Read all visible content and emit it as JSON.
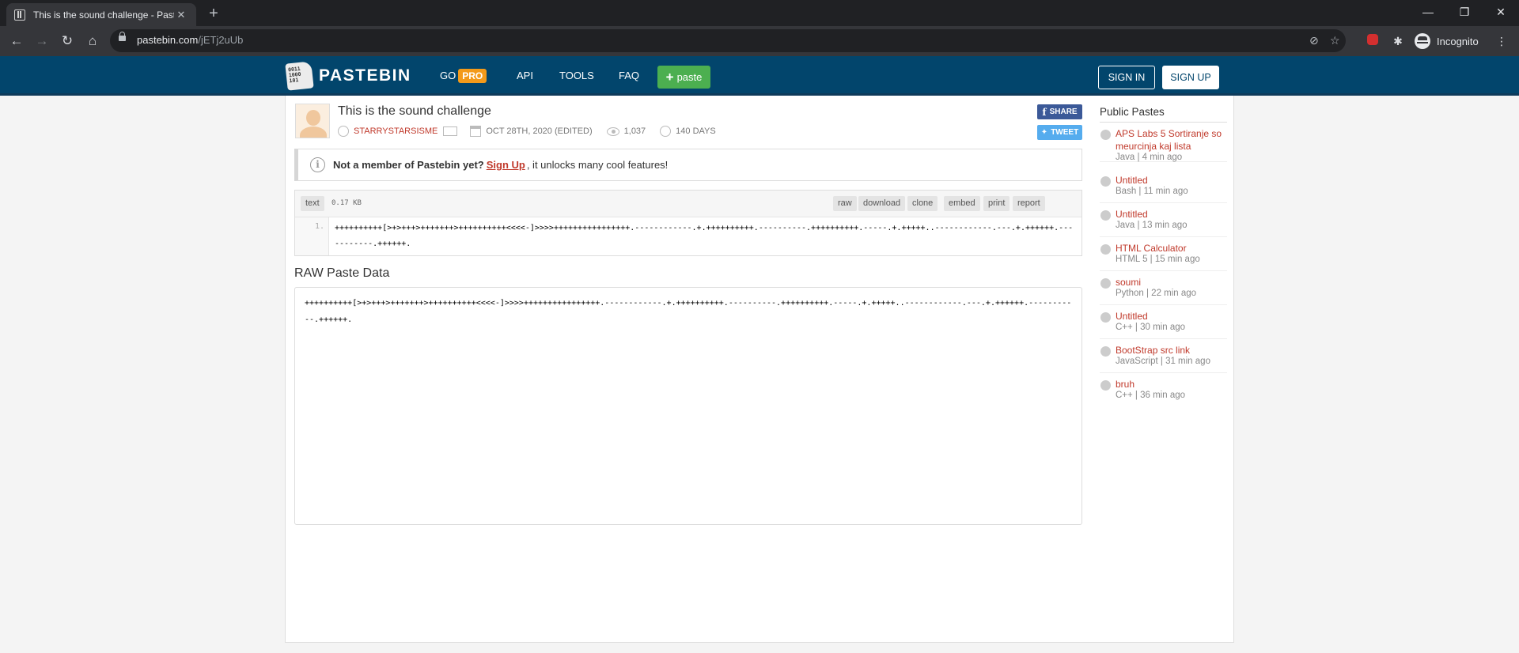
{
  "browser": {
    "tab_title": "This is the sound challenge - Past",
    "url_host": "pastebin.com",
    "url_path": "/jETj2uUb",
    "profile_label": "Incognito"
  },
  "header": {
    "logo_mark": "0011 1000 101",
    "logo_text": "PASTEBIN",
    "nav": {
      "go": "GO",
      "pro": "PRO",
      "api": "API",
      "tools": "TOOLS",
      "faq": "FAQ"
    },
    "new_paste": "paste",
    "sign_in": "SIGN IN",
    "sign_up": "SIGN UP"
  },
  "paste": {
    "title": "This is the sound challenge",
    "user": "STARRYSTARSISME",
    "date": "OCT 28TH, 2020 (EDITED)",
    "views": "1,037",
    "expires": "140 DAYS",
    "share": "SHARE",
    "tweet": "TWEET"
  },
  "notice": {
    "lead": "Not a member of Pastebin yet?",
    "link": "Sign Up",
    "rest": ", it unlocks many cool features!"
  },
  "code": {
    "syntax": "text",
    "size": "0.17 KB",
    "actions": [
      "raw",
      "download",
      "clone",
      "embed",
      "print",
      "report"
    ],
    "line_number": "1.",
    "content": "++++++++++[>+>+++>+++++++>++++++++++<<<<-]>>>>++++++++++++++++.------------.+.++++++++++.----------.++++++++++.-----.+.+++++..------------.---.+.++++++.-----------.++++++."
  },
  "raw": {
    "title": "RAW Paste Data",
    "content": "++++++++++[>+>+++>+++++++>++++++++++<<<<-]>>>>++++++++++++++++.------------.+.++++++++++.----------.++++++++++.-----.+.+++++..------------.---.+.++++++.-----------.++++++."
  },
  "sidebar": {
    "title": "Public Pastes",
    "items": [
      {
        "name": "APS Labs 5 Sortiranje so meurcinja kaj lista",
        "meta": "Java | 4 min ago"
      },
      {
        "name": "Untitled",
        "meta": "Bash | 11 min ago"
      },
      {
        "name": "Untitled",
        "meta": "Java | 13 min ago"
      },
      {
        "name": "HTML Calculator",
        "meta": "HTML 5 | 15 min ago"
      },
      {
        "name": "soumi",
        "meta": "Python | 22 min ago"
      },
      {
        "name": "Untitled",
        "meta": "C++ | 30 min ago"
      },
      {
        "name": "BootStrap src link",
        "meta": "JavaScript | 31 min ago"
      },
      {
        "name": "bruh",
        "meta": "C++ | 36 min ago"
      }
    ]
  },
  "colors": {
    "header_bg": "#02456c",
    "pro_badge": "#f39a1a",
    "paste_button": "#4caf50",
    "link_red": "#c0392b",
    "facebook": "#3b5998",
    "twitter": "#55acee"
  }
}
